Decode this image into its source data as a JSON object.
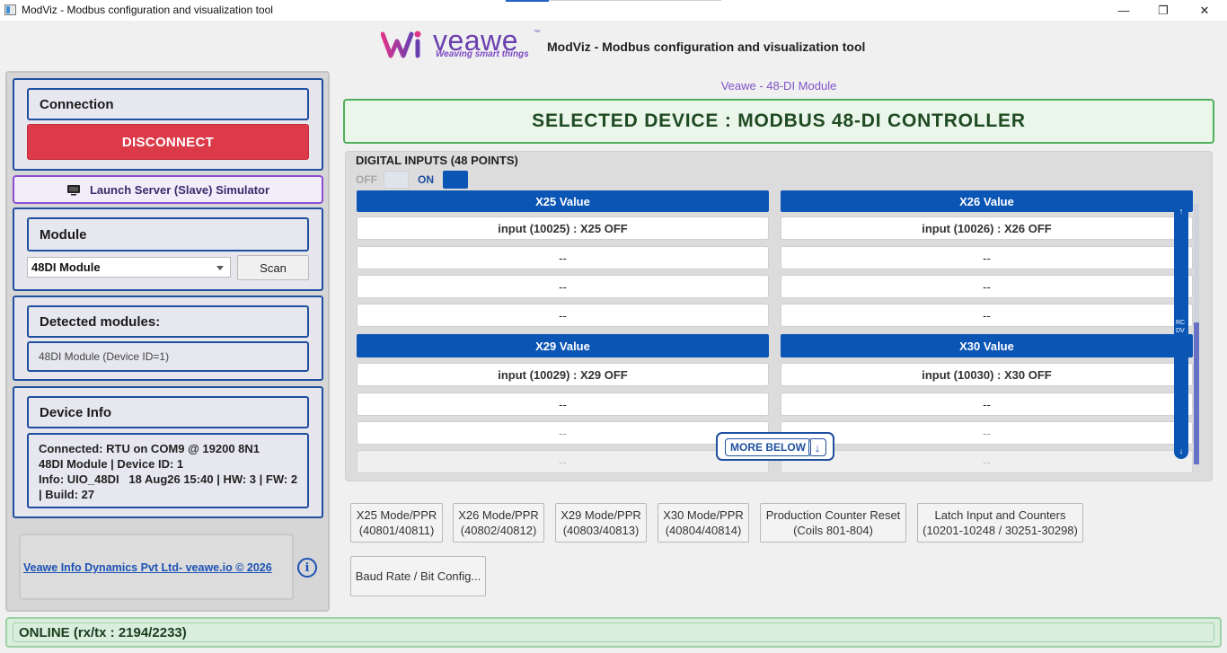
{
  "window": {
    "title": "ModViz - Modbus configuration and visualization tool",
    "minimize": "—",
    "maximize": "❐",
    "close": "✕"
  },
  "header": {
    "logo_word": "veawe",
    "logo_tagline": "Weaving smart things",
    "logo_tm": "™",
    "title": "ModViz - Modbus configuration and visualization tool",
    "module_subtitle": "Veawe - 48-DI Module"
  },
  "sidebar": {
    "connection": {
      "heading": "Connection",
      "disconnect_label": "DISCONNECT"
    },
    "simulator": {
      "label": "Launch Server (Slave) Simulator",
      "icon": "monitor-icon"
    },
    "module": {
      "heading": "Module",
      "selected": "48DI Module",
      "scan_label": "Scan"
    },
    "detected": {
      "heading": "Detected modules:",
      "value": "48DI Module (Device ID=1)"
    },
    "device_info": {
      "heading": "Device Info",
      "line1": "Connected: RTU on COM9 @ 19200 8N1",
      "line2": "48DI Module | Device ID: 1",
      "line3": "Info: UIO_48DI   18 Aug26 15:40 | HW: 3 | FW: 2",
      "line4": "| Build: 27"
    },
    "footer": {
      "link": "Veawe Info Dynamics Pvt Ltd- veawe.io © 2026",
      "info_icon": "i"
    }
  },
  "banner": {
    "text": "SELECTED DEVICE : MODBUS 48-DI CONTROLLER"
  },
  "digital_inputs": {
    "title": "DIGITAL INPUTS (48 POINTS)",
    "legend_off": "OFF",
    "legend_on": "ON",
    "columns": [
      {
        "header": "X25 Value",
        "cells": [
          "input (10025) : X25 OFF",
          "--",
          "--",
          "--"
        ]
      },
      {
        "header": "X26 Value",
        "cells": [
          "input (10026) : X26 OFF",
          "--",
          "--",
          "--"
        ]
      },
      {
        "header": "X29 Value",
        "cells": [
          "input (10029) : X29 OFF",
          "--",
          "--",
          "--"
        ]
      },
      {
        "header": "X30 Value",
        "cells": [
          "input (10030) : X30 OFF",
          "--",
          "--",
          "--"
        ]
      }
    ],
    "scroll_up": "↑",
    "scroll_down": "↓",
    "scroll_mid": "RC\nDV",
    "more_below": "MORE BELOW",
    "more_below_arrow": "↓"
  },
  "actions": [
    {
      "line1": "X25 Mode/PPR",
      "line2": "(40801/40811)"
    },
    {
      "line1": "X26 Mode/PPR",
      "line2": "(40802/40812)"
    },
    {
      "line1": "X29 Mode/PPR",
      "line2": "(40803/40813)"
    },
    {
      "line1": "X30 Mode/PPR",
      "line2": "(40804/40814)"
    },
    {
      "line1": "Production Counter Reset",
      "line2": "(Coils 801-804)"
    },
    {
      "line1": "Latch Input and Counters",
      "line2": "(10201-10248 / 30251-30298)"
    },
    {
      "line1": "Baud Rate / Bit Config..."
    }
  ],
  "status": {
    "text": "ONLINE (rx/tx : 2194/2233)"
  },
  "colors": {
    "accent_blue": "#0b55b5",
    "disconnect_red": "#dc3a48",
    "banner_green": "#4fb05b",
    "brand_purple": "#6a3fb0"
  }
}
